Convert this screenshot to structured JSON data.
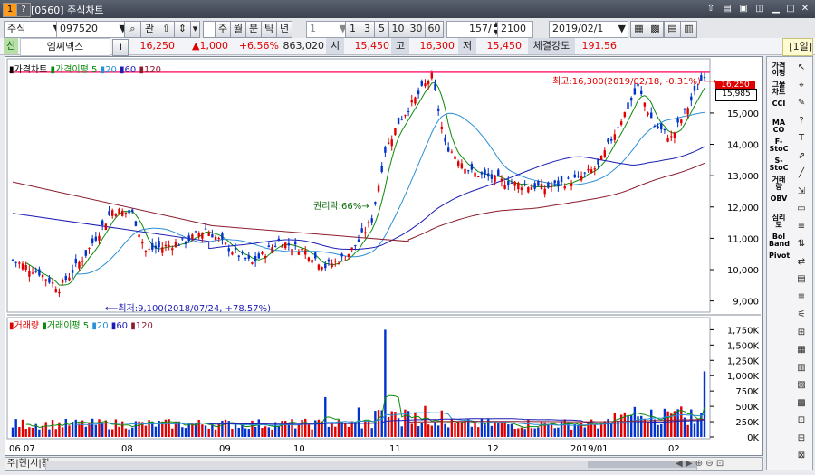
{
  "window": {
    "title": "[0560] 주식차트",
    "icon_label": "1",
    "icon2_label": "?"
  },
  "toolbar": {
    "market": "주식",
    "code": "097520",
    "btn_search": "관",
    "periods": [
      "주",
      "월",
      "분",
      "틱",
      "년"
    ],
    "interval_value": "1",
    "minute_options": [
      "1",
      "3",
      "5",
      "10",
      "30",
      "60"
    ],
    "count": "157",
    "count_sep": "/",
    "count_total": "2100",
    "date": "2019/02/1",
    "save_label": "1일"
  },
  "quote": {
    "indicator": "신",
    "name": "엠씨넥스",
    "info_btn": "i",
    "price": "16,250",
    "change": "▲1,000",
    "change_pct": "+6.56%",
    "volume": "863,020",
    "open_label": "시",
    "open": "15,450",
    "high_label": "고",
    "high": "16,300",
    "low_label": "저",
    "low": "15,450",
    "strength_label": "체결강도",
    "strength": "191.56",
    "period_badge": "[1일]"
  },
  "price_panel": {
    "legend": [
      {
        "label": "가격차트",
        "color": "#000000"
      },
      {
        "label": "가격이평 5",
        "color": "#0a8a0a"
      },
      {
        "label": "20",
        "color": "#2a8fd4"
      },
      {
        "label": "60",
        "color": "#1c1cb4"
      },
      {
        "label": "120",
        "color": "#8b1c2c"
      }
    ],
    "y_ticks": [
      "15,000",
      "14,000",
      "13,000",
      "12,000",
      "11,000",
      "10,000",
      "9,000"
    ],
    "current_price_tag": "16,250",
    "cursor_price_tag": "15,985",
    "high_annotation": "최고:16,300(2019/02/18, -0.31%)",
    "low_annotation": "최저:9,100(2018/07/24, +78.57%)",
    "rights_annotation": "권리락:66%"
  },
  "volume_panel": {
    "legend": [
      {
        "label": "거래량",
        "color": "#e00000"
      },
      {
        "label": "거래이평 5",
        "color": "#0a8a0a"
      },
      {
        "label": "20",
        "color": "#2a8fd4"
      },
      {
        "label": "60",
        "color": "#1c1cb4"
      },
      {
        "label": "120",
        "color": "#8b1c2c"
      }
    ],
    "y_ticks": [
      "1,750K",
      "1,500K",
      "1,250K",
      "1,000K",
      "750K",
      "500K",
      "250K",
      "0K"
    ]
  },
  "x_axis": {
    "ticks": [
      "06 07",
      "08",
      "09",
      "10",
      "11",
      "12",
      "2019/01",
      "02"
    ]
  },
  "side_tools": [
    "가격\n이평",
    "그물\n차트",
    "CCI",
    "MA\nCO",
    "F-\nStoC",
    "S-\nStoC",
    "거래\n량",
    "OBV",
    "심리\n도",
    "Bol\nBand",
    "Pivot"
  ],
  "bottom_tabs": [
    "주",
    "현",
    "시",
    "황"
  ],
  "chart_data": {
    "type": "candlestick",
    "title": "엠씨넥스 가격차트",
    "x_range": [
      "2018/06",
      "2019/02"
    ],
    "ylim": [
      8700,
      16500
    ],
    "reference_line": 16300,
    "closes_by_month": {
      "2018/06": 10300,
      "2018/07": 10100,
      "2018/08": 10900,
      "2018/09": 10700,
      "2018/10": 10400,
      "2018/11": 14000,
      "2018/12": 12400,
      "2019/01": 13200,
      "2019/02": 16250
    },
    "volume_ylim": [
      0,
      1800000
    ],
    "volume_peak": 1750000
  }
}
